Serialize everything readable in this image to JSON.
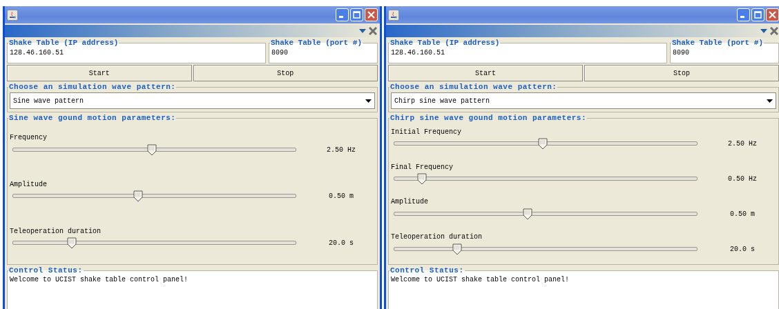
{
  "windows": [
    {
      "ip_field": {
        "legend": "Shake Table (IP address)",
        "value": "128.46.160.51"
      },
      "port_field": {
        "legend": "Shake Table (port #)",
        "value": "8090"
      },
      "buttons": [
        "Start",
        "Stop"
      ],
      "pattern": {
        "legend": "Choose an simulation wave pattern:",
        "value": "Sine wave pattern"
      },
      "parameters": {
        "legend": "Sine wave gound motion parameters:",
        "sliders": [
          {
            "label": "Frequency",
            "level": 0.49,
            "reading": "2.50 Hz"
          },
          {
            "label": "Amplitude",
            "level": 0.44,
            "reading": "0.50 m"
          },
          {
            "label": "Teleoperation duration",
            "level": 0.2,
            "reading": "20.0 s"
          }
        ]
      },
      "status": {
        "legend": "Control Status:",
        "text": "Welcome to UCIST shake table control panel!"
      }
    },
    {
      "ip_field": {
        "legend": "Shake Table (IP address)",
        "value": "128.46.160.51"
      },
      "port_field": {
        "legend": "Shake Table (port #)",
        "value": "8090"
      },
      "buttons": [
        "Start",
        "Stop"
      ],
      "pattern": {
        "legend": "Choose an simulation wave pattern:",
        "value": "Chirp sine wave pattern"
      },
      "parameters": {
        "legend": "Chirp sine wave gound motion parameters:",
        "sliders": [
          {
            "label": "Initial Frequency",
            "level": 0.49,
            "reading": "2.50 Hz"
          },
          {
            "label": "Final Frequency",
            "level": 0.08,
            "reading": "0.50 Hz"
          },
          {
            "label": "Amplitude",
            "level": 0.44,
            "reading": "0.50 m"
          },
          {
            "label": "Teleoperation duration",
            "level": 0.2,
            "reading": "20.0 s"
          }
        ]
      },
      "status": {
        "legend": "Control Status:",
        "text": "Welcome to UCIST shake table control panel!"
      }
    }
  ]
}
